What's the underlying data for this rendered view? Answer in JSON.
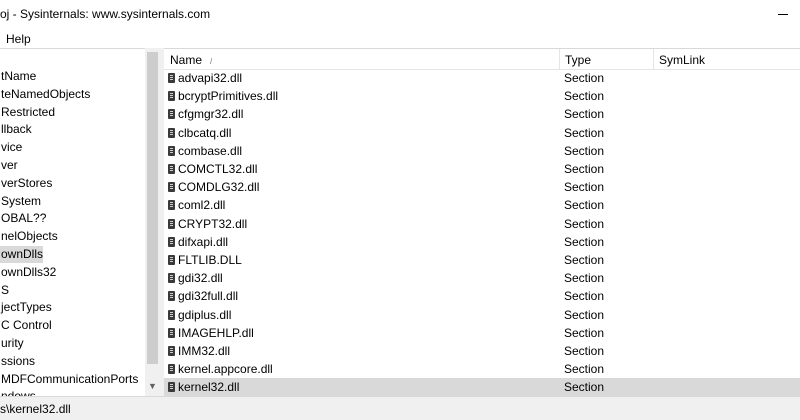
{
  "window": {
    "title": "oj - Sysinternals: www.sysinternals.com"
  },
  "menu": {
    "items": [
      "Help"
    ]
  },
  "tree": {
    "items": [
      {
        "label": "tName",
        "selected": false
      },
      {
        "label": "teNamedObjects",
        "selected": false
      },
      {
        "label": "Restricted",
        "selected": false
      },
      {
        "label": "llback",
        "selected": false
      },
      {
        "label": "vice",
        "selected": false
      },
      {
        "label": "ver",
        "selected": false
      },
      {
        "label": "verStores",
        "selected": false
      },
      {
        "label": "System",
        "selected": false
      },
      {
        "label": "OBAL??",
        "selected": false
      },
      {
        "label": "nelObjects",
        "selected": false
      },
      {
        "label": "ownDlls",
        "selected": true
      },
      {
        "label": "ownDlls32",
        "selected": false
      },
      {
        "label": "S",
        "selected": false
      },
      {
        "label": "jectTypes",
        "selected": false
      },
      {
        "label": "C Control",
        "selected": false
      },
      {
        "label": "urity",
        "selected": false
      },
      {
        "label": "ssions",
        "selected": false
      },
      {
        "label": "MDFCommunicationPorts",
        "selected": false
      },
      {
        "label": "ndows",
        "selected": false
      }
    ]
  },
  "list": {
    "columns": {
      "name": "Name",
      "type": "Type",
      "symlink": "SymLink"
    },
    "rows": [
      {
        "name": "advapi32.dll",
        "type": "Section",
        "selected": false
      },
      {
        "name": "bcryptPrimitives.dll",
        "type": "Section",
        "selected": false
      },
      {
        "name": "cfgmgr32.dll",
        "type": "Section",
        "selected": false
      },
      {
        "name": "clbcatq.dll",
        "type": "Section",
        "selected": false
      },
      {
        "name": "combase.dll",
        "type": "Section",
        "selected": false
      },
      {
        "name": "COMCTL32.dll",
        "type": "Section",
        "selected": false
      },
      {
        "name": "COMDLG32.dll",
        "type": "Section",
        "selected": false
      },
      {
        "name": "coml2.dll",
        "type": "Section",
        "selected": false
      },
      {
        "name": "CRYPT32.dll",
        "type": "Section",
        "selected": false
      },
      {
        "name": "difxapi.dll",
        "type": "Section",
        "selected": false
      },
      {
        "name": "FLTLIB.DLL",
        "type": "Section",
        "selected": false
      },
      {
        "name": "gdi32.dll",
        "type": "Section",
        "selected": false
      },
      {
        "name": "gdi32full.dll",
        "type": "Section",
        "selected": false
      },
      {
        "name": "gdiplus.dll",
        "type": "Section",
        "selected": false
      },
      {
        "name": "IMAGEHLP.dll",
        "type": "Section",
        "selected": false
      },
      {
        "name": "IMM32.dll",
        "type": "Section",
        "selected": false
      },
      {
        "name": "kernel.appcore.dll",
        "type": "Section",
        "selected": false
      },
      {
        "name": "kernel32.dll",
        "type": "Section",
        "selected": true
      }
    ]
  },
  "status": {
    "path": "s\\kernel32.dll"
  }
}
